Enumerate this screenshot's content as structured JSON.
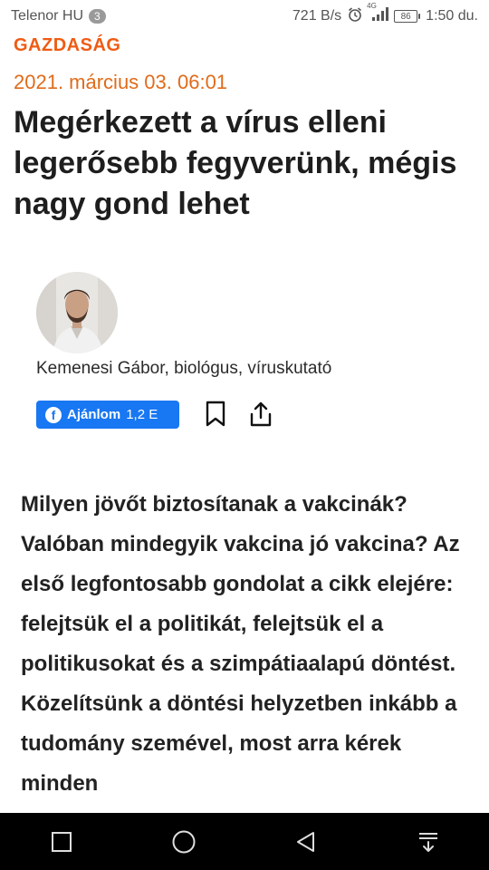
{
  "status_bar": {
    "carrier": "Telenor HU",
    "sim_badge": "3",
    "net_speed": "721 B/s",
    "network": "4G",
    "battery": "86",
    "time": "1:50 du."
  },
  "article": {
    "section": "GAZDASÁG",
    "date": "2021. március 03. 06:01",
    "title": "Megérkezett a vírus elleni legerősebb fegyverünk, mégis nagy gond lehet",
    "author": "Kemenesi Gábor, biológus, víruskutató",
    "like_label": "Ajánlom",
    "like_count": "1,2 E",
    "lead": "Milyen jövőt biztosítanak a vakcinák? Valóban mindegyik vakcina jó vakcina? Az első legfontosabb gondolat a cikk elejére: felejtsük el a politikát, felejtsük el a politikusokat és a szimpátiaalapú döntést. Közelítsünk a döntési helyzetben inkább a tudomány szemével, most arra kérek minden"
  },
  "colors": {
    "accent": "#ef5b14",
    "date": "#e06b1a",
    "facebook": "#1877f2"
  },
  "icons": {
    "alarm": "alarm-icon",
    "signal": "signal-icon",
    "battery": "battery-icon",
    "bookmark": "bookmark-icon",
    "share": "share-icon",
    "facebook": "facebook-icon",
    "nav_recents": "square-icon",
    "nav_home": "circle-icon",
    "nav_back": "triangle-back-icon",
    "nav_notifications": "pull-down-icon"
  }
}
